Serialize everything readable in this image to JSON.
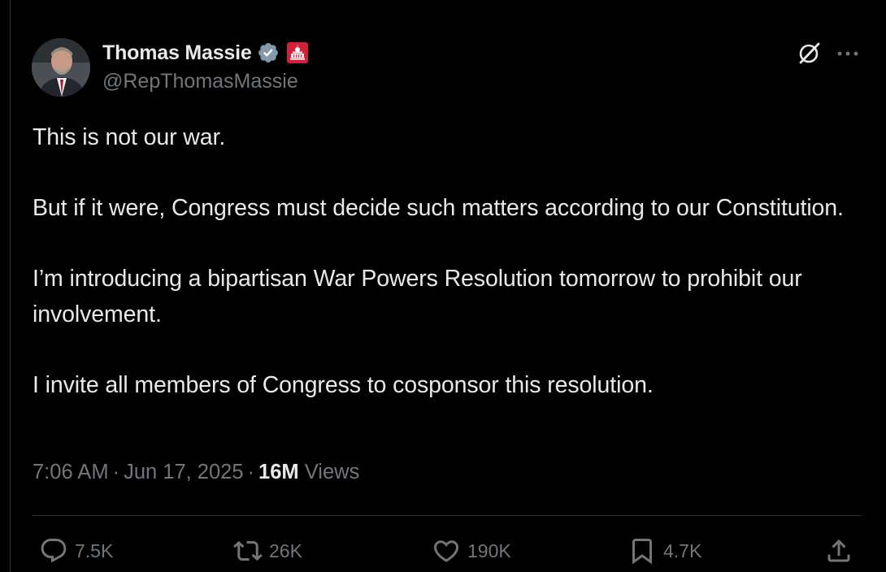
{
  "author": {
    "display_name": "Thomas Massie",
    "handle": "@RepThomasMassie",
    "verified": true,
    "affiliation_badge": "us-capitol-badge"
  },
  "tweet": {
    "paragraphs": [
      "This is not our war.",
      "But if it were, Congress must decide such matters according to our Constitution.",
      "I’m introducing a bipartisan War Powers Resolution tomorrow to prohibit our involvement.",
      "I invite all members of Congress to cosponsor this resolution."
    ]
  },
  "meta": {
    "time": "7:06 AM",
    "separator": "·",
    "date": "Jun 17, 2025",
    "views_count": "16M",
    "views_label": "Views"
  },
  "actions": {
    "replies": "7.5K",
    "reposts": "26K",
    "likes": "190K",
    "bookmarks": "4.7K"
  },
  "icons": [
    "verified-badge-icon",
    "capitol-badge-icon",
    "grok-icon",
    "more-icon",
    "reply-icon",
    "repost-icon",
    "like-icon",
    "bookmark-icon",
    "share-icon"
  ],
  "colors": {
    "background": "#000000",
    "text": "#e7e9ea",
    "secondary_text": "#71767b",
    "verified_badge": "#829aab",
    "gov_badge": "#d41f3a",
    "divider": "#2f3336"
  }
}
